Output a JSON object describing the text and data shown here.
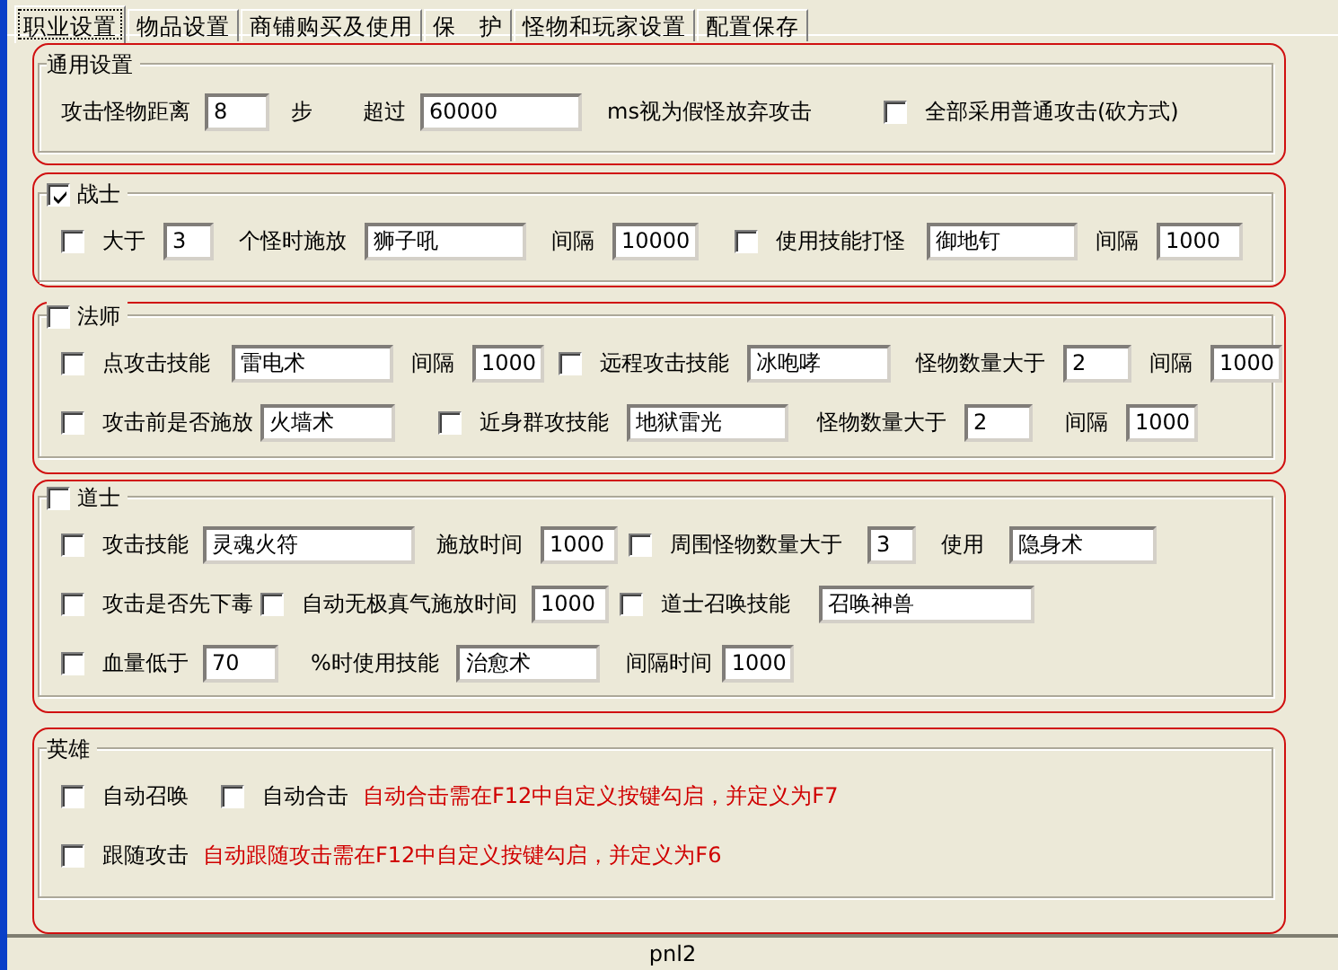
{
  "tabs": [
    {
      "label": "职业设置",
      "selected": true
    },
    {
      "label": "物品设置",
      "selected": false
    },
    {
      "label": "商铺购买及使用",
      "selected": false
    },
    {
      "label": "保　护",
      "selected": false
    },
    {
      "label": "怪物和玩家设置",
      "selected": false
    },
    {
      "label": "配置保存",
      "selected": false
    }
  ],
  "groups": [
    {
      "title": "通用设置",
      "lines": [
        [
          {
            "kind": "label",
            "text": "攻击怪物距离"
          },
          {
            "kind": "field",
            "value": "8"
          },
          {
            "kind": "label",
            "text": "步"
          },
          {
            "kind": "label",
            "text": "超过"
          },
          {
            "kind": "field",
            "value": "60000"
          },
          {
            "kind": "label",
            "text": "ms视为假怪放弃攻击"
          },
          {
            "kind": "checkbox",
            "label": "全部采用普通攻击(砍方式)",
            "checked": false
          }
        ]
      ]
    },
    {
      "title": "战士",
      "checked": true,
      "lines": [
        [
          {
            "kind": "checkbox",
            "label": "大于",
            "checked": false
          },
          {
            "kind": "field",
            "value": "3"
          },
          {
            "kind": "label",
            "text": "个怪时施放"
          },
          {
            "kind": "field",
            "value": "狮子吼"
          },
          {
            "kind": "label",
            "text": "间隔"
          },
          {
            "kind": "field",
            "value": "10000"
          },
          {
            "kind": "checkbox",
            "label": "使用技能打怪",
            "checked": false
          },
          {
            "kind": "field",
            "value": "御地钉"
          },
          {
            "kind": "label",
            "text": "间隔"
          },
          {
            "kind": "field",
            "value": "1000"
          }
        ]
      ]
    },
    {
      "title": "法师",
      "checked": false,
      "lines": [
        [
          {
            "kind": "checkbox",
            "label": "点攻击技能",
            "checked": false
          },
          {
            "kind": "field",
            "value": "雷电术"
          },
          {
            "kind": "label",
            "text": "间隔"
          },
          {
            "kind": "field",
            "value": "1000"
          },
          {
            "kind": "checkbox",
            "label": "远程攻击技能",
            "checked": false
          },
          {
            "kind": "field",
            "value": "冰咆哮"
          },
          {
            "kind": "label",
            "text": "怪物数量大于"
          },
          {
            "kind": "field",
            "value": "2"
          },
          {
            "kind": "label",
            "text": "间隔"
          },
          {
            "kind": "field",
            "value": "1000"
          }
        ],
        [
          {
            "kind": "checkbox",
            "label": "攻击前是否施放",
            "checked": false
          },
          {
            "kind": "field",
            "value": "火墙术"
          },
          {
            "kind": "checkbox",
            "label": "近身群攻技能",
            "checked": false
          },
          {
            "kind": "field",
            "value": "地狱雷光"
          },
          {
            "kind": "label",
            "text": "怪物数量大于"
          },
          {
            "kind": "field",
            "value": "2"
          },
          {
            "kind": "label",
            "text": "间隔"
          },
          {
            "kind": "field",
            "value": "1000"
          }
        ]
      ]
    },
    {
      "title": "道士",
      "checked": false,
      "lines": [
        [
          {
            "kind": "checkbox",
            "label": "攻击技能",
            "checked": false
          },
          {
            "kind": "field",
            "value": "灵魂火符"
          },
          {
            "kind": "label",
            "text": "施放时间"
          },
          {
            "kind": "field",
            "value": "1000"
          },
          {
            "kind": "checkbox",
            "label": "周围怪物数量大于",
            "checked": false
          },
          {
            "kind": "field",
            "value": "3"
          },
          {
            "kind": "label",
            "text": "使用"
          },
          {
            "kind": "field",
            "value": "隐身术"
          }
        ],
        [
          {
            "kind": "checkbox",
            "label": "攻击是否先下毒",
            "checked": false
          },
          {
            "kind": "checkbox",
            "label": "自动无极真气施放时间",
            "checked": false
          },
          {
            "kind": "field",
            "value": "1000"
          },
          {
            "kind": "checkbox",
            "label": "道士召唤技能",
            "checked": false
          },
          {
            "kind": "field",
            "value": "召唤神兽"
          }
        ],
        [
          {
            "kind": "checkbox",
            "label": "血量低于",
            "checked": false
          },
          {
            "kind": "field",
            "value": "70"
          },
          {
            "kind": "label",
            "text": "%时使用技能"
          },
          {
            "kind": "field",
            "value": "治愈术"
          },
          {
            "kind": "label",
            "text": "间隔时间"
          },
          {
            "kind": "field",
            "value": "1000"
          }
        ]
      ]
    },
    {
      "title": "英雄",
      "lines": [
        [
          {
            "kind": "checkbox",
            "label": "自动召唤",
            "checked": false
          },
          {
            "kind": "checkbox",
            "label": "自动合击",
            "checked": false
          },
          {
            "kind": "note",
            "text": "自动合击需在F12中自定义按键勾启，并定义为F7"
          }
        ],
        [
          {
            "kind": "checkbox",
            "label": "跟随攻击",
            "checked": false
          },
          {
            "kind": "note",
            "text": "自动跟随攻击需在F12中自定义按键勾启，并定义为F6"
          }
        ]
      ]
    }
  ],
  "status_bar": "pnl2"
}
